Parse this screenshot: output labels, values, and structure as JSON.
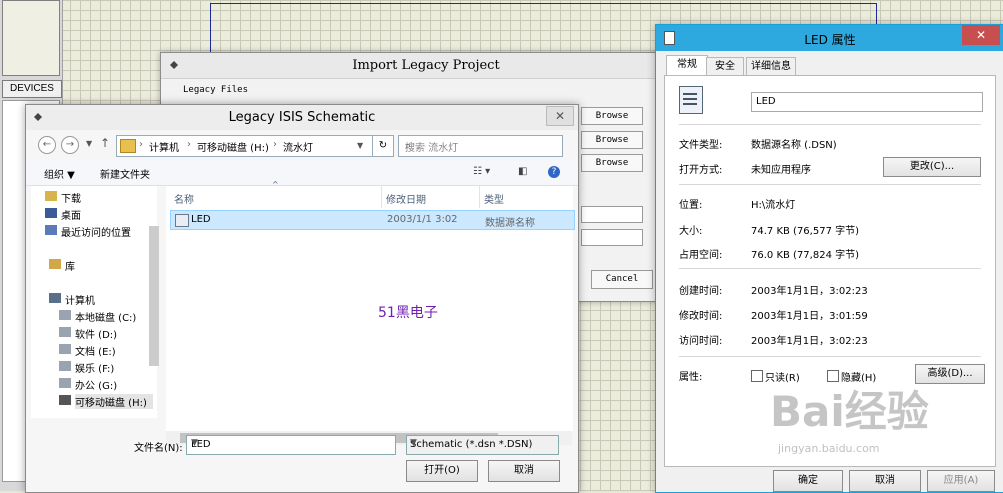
{
  "background": {
    "devices_label": "DEVICES"
  },
  "import_dialog": {
    "title": "Import Legacy Project",
    "group_label": "Legacy Files",
    "browse_labels": [
      "Browse",
      "Browse",
      "Browse"
    ],
    "cancel_label": "Cancel"
  },
  "file_dialog": {
    "title": "Legacy ISIS Schematic",
    "close_glyph": "✕",
    "breadcrumb": [
      "计算机",
      "可移动磁盘 (H:)",
      "流水灯"
    ],
    "search_placeholder": "搜索 流水灯",
    "toolbar": {
      "organize": "组织 ▼",
      "new_folder": "新建文件夹"
    },
    "sidebar": [
      {
        "label": "下载",
        "icon": "download-folder-icon"
      },
      {
        "label": "桌面",
        "icon": "desktop-icon"
      },
      {
        "label": "最近访问的位置",
        "icon": "recent-places-icon"
      },
      {
        "label": "库",
        "icon": "library-icon"
      },
      {
        "label": "计算机",
        "icon": "computer-icon"
      },
      {
        "label": "本地磁盘 (C:)",
        "icon": "drive-icon"
      },
      {
        "label": "软件 (D:)",
        "icon": "drive-icon"
      },
      {
        "label": "文档 (E:)",
        "icon": "drive-icon"
      },
      {
        "label": "娱乐 (F:)",
        "icon": "drive-icon"
      },
      {
        "label": "办公 (G:)",
        "icon": "drive-icon"
      },
      {
        "label": "可移动磁盘 (H:)",
        "icon": "removable-drive-icon"
      }
    ],
    "columns": {
      "name": "名称",
      "date": "修改日期",
      "type": "类型"
    },
    "files": [
      {
        "name": "LED",
        "date": "2003/1/1 3:02",
        "type": "数据源名称"
      }
    ],
    "watermark": "51黑电子",
    "filename_label": "文件名(N):",
    "filename_value": "LED",
    "filetype_value": "Schematic (*.dsn *.DSN)",
    "open_label": "打开(O)",
    "cancel_label": "取消"
  },
  "prop_dialog": {
    "title": "LED 属性",
    "close_glyph": "✕",
    "tabs": [
      "常规",
      "安全",
      "详细信息"
    ],
    "name": "LED",
    "rows": {
      "file_type_label": "文件类型:",
      "file_type": "数据源名称 (.DSN)",
      "open_with_label": "打开方式:",
      "open_with": "未知应用程序",
      "change_label": "更改(C)...",
      "location_label": "位置:",
      "location": "H:\\流水灯",
      "size_label": "大小:",
      "size": "74.7 KB (76,577 字节)",
      "disk_label": "占用空间:",
      "disk": "76.0 KB (77,824 字节)",
      "created_label": "创建时间:",
      "created": "2003年1月1日，3:02:23",
      "modified_label": "修改时间:",
      "modified": "2003年1月1日，3:01:59",
      "accessed_label": "访问时间:",
      "accessed": "2003年1月1日，3:02:23",
      "attr_label": "属性:",
      "readonly": "只读(R)",
      "hidden": "隐藏(H)",
      "advanced": "高级(D)..."
    },
    "ok_label": "确定",
    "cancel_label": "取消",
    "apply_label": "应用(A)"
  },
  "watermark": {
    "brand": "Bai经验",
    "url": "jingyan.baidu.com"
  }
}
